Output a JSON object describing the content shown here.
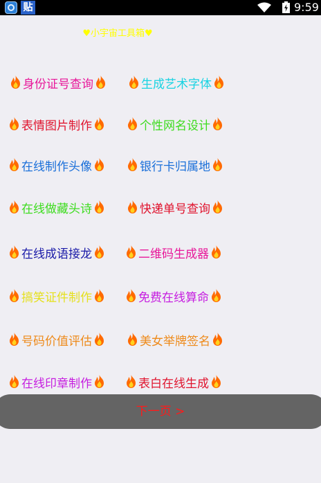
{
  "status_bar": {
    "app_badge": "贴",
    "time": "9:59"
  },
  "title": "♥小宇宙工具箱♥",
  "colors": {
    "title": "#ffff00",
    "next_button_bg": "#646464",
    "next_button_text": "#ff1a1a",
    "fire": "#ff6a00"
  },
  "icons": {
    "tool_decoration": "fire-icon"
  },
  "tools": [
    {
      "label": "身份证号查询",
      "color": "#e8179a"
    },
    {
      "label": "生成艺术字体",
      "color": "#19d3e2"
    },
    {
      "label": "表情图片制作",
      "color": "#e0142e"
    },
    {
      "label": "个性网名设计",
      "color": "#3ddc1e"
    },
    {
      "label": "在线制作头像",
      "color": "#1a6fd9"
    },
    {
      "label": "银行卡归属地",
      "color": "#1a6fd9"
    },
    {
      "label": "在线做藏头诗",
      "color": "#3ddc1e"
    },
    {
      "label": "快递单号查询",
      "color": "#e0142e"
    },
    {
      "label": "在线成语接龙",
      "color": "#1a1aa8"
    },
    {
      "label": "二维码生成器",
      "color": "#e8179a"
    },
    {
      "label": "搞笑证件制作",
      "color": "#e5e01e"
    },
    {
      "label": "免费在线算命",
      "color": "#c61ee0"
    },
    {
      "label": "号码价值评估",
      "color": "#ee8a1a"
    },
    {
      "label": "美女举牌签名",
      "color": "#ee8a1a"
    },
    {
      "label": "在线印章制作",
      "color": "#c61ee0"
    },
    {
      "label": "表白在线生成",
      "color": "#e0142e"
    }
  ],
  "next_button": {
    "label": "下一页 >"
  }
}
